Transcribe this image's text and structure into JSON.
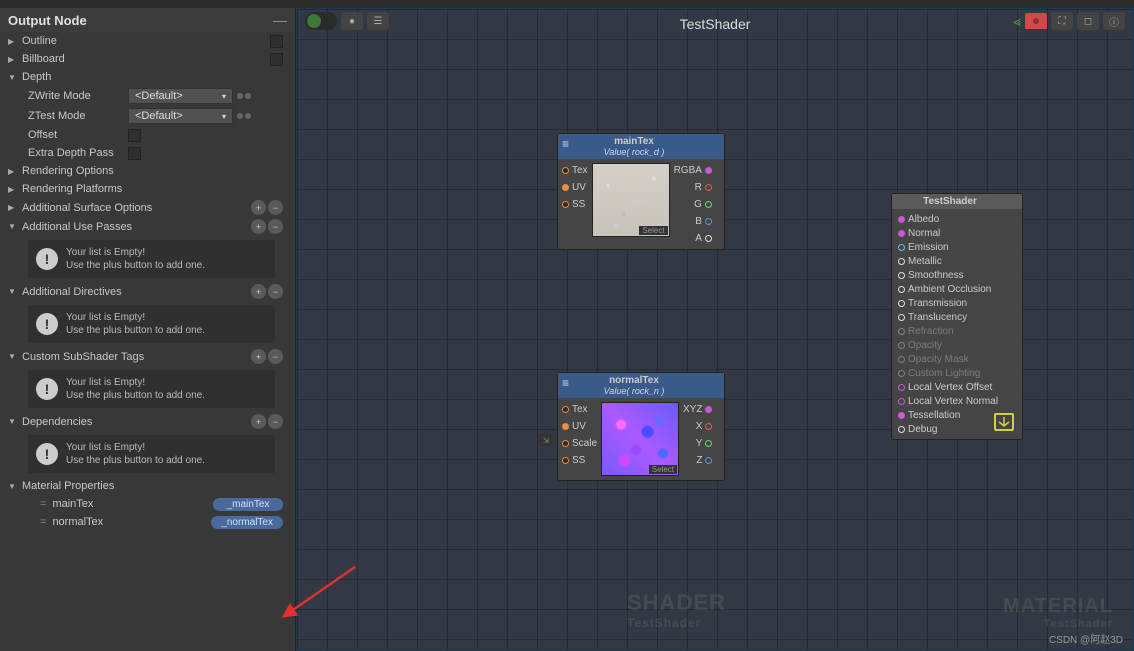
{
  "tab": {
    "title": "TestShader"
  },
  "sidebar": {
    "title": "Output Node",
    "outline": "Outline",
    "billboard": "Billboard",
    "depth": {
      "label": "Depth",
      "zwrite": "ZWrite Mode",
      "ztest": "ZTest Mode",
      "offset": "Offset",
      "extra": "Extra Depth Pass",
      "default": "<Default>"
    },
    "rendering_options": "Rendering Options",
    "rendering_platforms": "Rendering Platforms",
    "surface_options": "Additional Surface Options",
    "use_passes": "Additional Use Passes",
    "directives": "Additional Directives",
    "subshader_tags": "Custom SubShader Tags",
    "dependencies": "Dependencies",
    "material_props": "Material Properties",
    "empty": {
      "title": "Your list is Empty!",
      "sub": "Use the plus button to add one."
    },
    "props": [
      {
        "name": "mainTex",
        "tag": "_mainTex"
      },
      {
        "name": "normalTex",
        "tag": "_normalTex"
      }
    ]
  },
  "graph": {
    "title": "TestShader",
    "nodes": {
      "maintex": {
        "title": "mainTex",
        "sub": "Value( rock_d )",
        "inputs": [
          "Tex",
          "UV",
          "SS"
        ],
        "outputs": [
          "RGBA",
          "R",
          "G",
          "B",
          "A"
        ],
        "select": "Select"
      },
      "normaltex": {
        "title": "normalTex",
        "sub": "Value( rock_n )",
        "inputs": [
          "Tex",
          "UV",
          "Scale",
          "SS"
        ],
        "outputs": [
          "XYZ",
          "X",
          "Y",
          "Z"
        ],
        "select": "Select"
      },
      "output": {
        "title": "TestShader",
        "ports": [
          "Albedo",
          "Normal",
          "Emission",
          "Metallic",
          "Smoothness",
          "Ambient Occlusion",
          "Transmission",
          "Translucency",
          "Refraction",
          "Opacity",
          "Opacity Mask",
          "Custom Lighting",
          "Local Vertex Offset",
          "Local Vertex Normal",
          "Tessellation",
          "Debug"
        ]
      }
    },
    "watermarks": {
      "shader": "SHADER",
      "shader_name": "TestShader",
      "material": "MATERIAL",
      "material_name": "TestShader"
    }
  },
  "footer": {
    "csdn": "CSDN @阿赵3D"
  }
}
